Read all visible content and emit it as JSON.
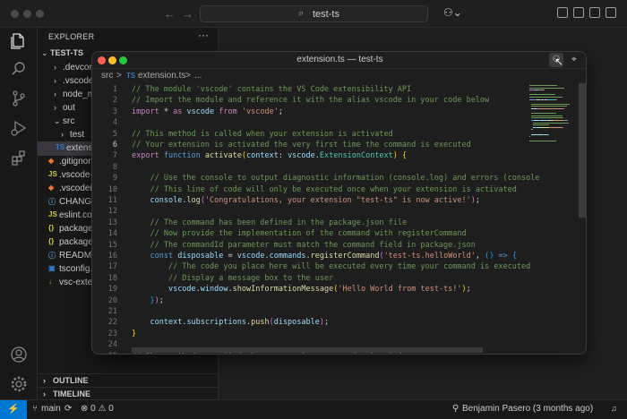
{
  "titlebar": {
    "command_center": "test-ts",
    "back_icon": "arrow-left-icon",
    "forward_icon": "arrow-right-icon",
    "copilot_icon": "copilot-icon"
  },
  "activity_bar": [
    "explorer-icon",
    "search-icon",
    "source-control-icon",
    "run-debug-icon",
    "extensions-icon",
    "accounts-icon",
    "manage-gear-icon"
  ],
  "sidebar": {
    "title": "EXPLORER",
    "more": "···",
    "root": "TEST-TS",
    "items": [
      {
        "label": ".devcontai",
        "icon": "",
        "chev": "›"
      },
      {
        "label": ".vscode",
        "icon": "",
        "chev": "›"
      },
      {
        "label": "node_mod",
        "icon": "",
        "chev": "›"
      },
      {
        "label": "out",
        "icon": "",
        "chev": "›"
      },
      {
        "label": "src",
        "icon": "",
        "chev": "⌄"
      },
      {
        "label": "test",
        "icon": "",
        "chev": "›"
      },
      {
        "label": "extensio",
        "icon": "TS",
        "chev": ""
      },
      {
        "label": ".gitignore",
        "icon": "◆",
        "chev": ""
      },
      {
        "label": ".vscode-t",
        "icon": "JS",
        "chev": ""
      },
      {
        "label": ".vscodeig",
        "icon": "◆",
        "chev": ""
      },
      {
        "label": "CHANGEL",
        "icon": "ⓘ",
        "chev": ""
      },
      {
        "label": "eslint.con",
        "icon": "JS",
        "chev": ""
      },
      {
        "label": "package-",
        "icon": "{}",
        "chev": ""
      },
      {
        "label": "package.j",
        "icon": "{}",
        "chev": ""
      },
      {
        "label": "README.",
        "icon": "ⓘ",
        "chev": ""
      },
      {
        "label": "tsconfig.j",
        "icon": "▣",
        "chev": ""
      },
      {
        "label": "vsc-exten",
        "icon": "↓",
        "chev": ""
      }
    ],
    "outline": "OUTLINE",
    "timeline": "TIMELINE"
  },
  "statusbar": {
    "remote": "⚡",
    "branch": "main",
    "sync": "⟳",
    "problems": "⊗ 0 ⚠ 0",
    "blame": "Benjamin Pasero (3 months ago)",
    "bell": "🔔"
  },
  "editor_window": {
    "title": "extension.ts — test-ts",
    "breadcrumbs": [
      "src",
      ">",
      "TS",
      "extension.ts",
      ">",
      "..."
    ],
    "cursor_line": 6,
    "lines": [
      {
        "n": "1",
        "tokens": [
          [
            "c-com",
            "// The module 'vscode' contains the VS Code extensibility API"
          ]
        ]
      },
      {
        "n": "2",
        "tokens": [
          [
            "c-com",
            "// Import the module and reference it with the alias vscode in your code below"
          ]
        ]
      },
      {
        "n": "3",
        "tokens": [
          [
            "c-kw2",
            "import"
          ],
          [
            "c-op",
            " * "
          ],
          [
            "c-kw2",
            "as"
          ],
          [
            "c-var",
            " vscode "
          ],
          [
            "c-kw2",
            "from"
          ],
          [
            "c-str",
            " 'vscode'"
          ],
          [
            "c-op",
            ";"
          ]
        ]
      },
      {
        "n": "4",
        "tokens": []
      },
      {
        "n": "5",
        "tokens": [
          [
            "c-com",
            "// This method is called when your extension is activated"
          ]
        ]
      },
      {
        "n": "6",
        "tokens": [
          [
            "c-com",
            "// Your extension is activated the very first time the command is executed"
          ]
        ]
      },
      {
        "n": "7",
        "tokens": [
          [
            "c-kw2",
            "export"
          ],
          [
            "c-kw",
            " function "
          ],
          [
            "c-fn",
            "activate"
          ],
          [
            "c-br",
            "("
          ],
          [
            "c-var",
            "context"
          ],
          [
            "c-op",
            ": "
          ],
          [
            "c-var",
            "vscode"
          ],
          [
            "c-op",
            "."
          ],
          [
            "c-type",
            "ExtensionContext"
          ],
          [
            "c-br",
            ")"
          ],
          [
            "c-op",
            " "
          ],
          [
            "c-br",
            "{"
          ]
        ]
      },
      {
        "n": "8",
        "tokens": []
      },
      {
        "n": "9",
        "tokens": [
          [
            "c-op",
            "    "
          ],
          [
            "c-com",
            "// Use the console to output diagnostic information (console.log) and errors (console"
          ]
        ]
      },
      {
        "n": "10",
        "tokens": [
          [
            "c-op",
            "    "
          ],
          [
            "c-com",
            "// This line of code will only be executed once when your extension is activated"
          ]
        ]
      },
      {
        "n": "11",
        "tokens": [
          [
            "c-op",
            "    "
          ],
          [
            "c-var",
            "console"
          ],
          [
            "c-op",
            "."
          ],
          [
            "c-fn",
            "log"
          ],
          [
            "c-br2",
            "("
          ],
          [
            "c-str",
            "'Congratulations, your extension \"test-ts\" is now active!'"
          ],
          [
            "c-br2",
            ")"
          ],
          [
            "c-op",
            ";"
          ]
        ]
      },
      {
        "n": "12",
        "tokens": []
      },
      {
        "n": "13",
        "tokens": [
          [
            "c-op",
            "    "
          ],
          [
            "c-com",
            "// The command has been defined in the package.json file"
          ]
        ]
      },
      {
        "n": "14",
        "tokens": [
          [
            "c-op",
            "    "
          ],
          [
            "c-com",
            "// Now provide the implementation of the command with registerCommand"
          ]
        ]
      },
      {
        "n": "15",
        "tokens": [
          [
            "c-op",
            "    "
          ],
          [
            "c-com",
            "// The commandId parameter must match the command field in package.json"
          ]
        ]
      },
      {
        "n": "16",
        "tokens": [
          [
            "c-op",
            "    "
          ],
          [
            "c-kw",
            "const"
          ],
          [
            "c-var",
            " disposable "
          ],
          [
            "c-op",
            "= "
          ],
          [
            "c-var",
            "vscode"
          ],
          [
            "c-op",
            "."
          ],
          [
            "c-var",
            "commands"
          ],
          [
            "c-op",
            "."
          ],
          [
            "c-fn",
            "registerCommand"
          ],
          [
            "c-br2",
            "("
          ],
          [
            "c-str",
            "'test-ts.helloWorld'"
          ],
          [
            "c-op",
            ", "
          ],
          [
            "c-br3",
            "()"
          ],
          [
            "c-kw",
            " => "
          ],
          [
            "c-br3",
            "{"
          ]
        ]
      },
      {
        "n": "17",
        "tokens": [
          [
            "c-op",
            "        "
          ],
          [
            "c-com",
            "// The code you place here will be executed every time your command is executed"
          ]
        ]
      },
      {
        "n": "18",
        "tokens": [
          [
            "c-op",
            "        "
          ],
          [
            "c-com",
            "// Display a message box to the user"
          ]
        ]
      },
      {
        "n": "19",
        "tokens": [
          [
            "c-op",
            "        "
          ],
          [
            "c-var",
            "vscode"
          ],
          [
            "c-op",
            "."
          ],
          [
            "c-var",
            "window"
          ],
          [
            "c-op",
            "."
          ],
          [
            "c-fn",
            "showInformationMessage"
          ],
          [
            "c-br",
            "("
          ],
          [
            "c-str",
            "'Hello World from test-ts!'"
          ],
          [
            "c-br",
            ")"
          ],
          [
            "c-op",
            ";"
          ]
        ]
      },
      {
        "n": "20",
        "tokens": [
          [
            "c-op",
            "    "
          ],
          [
            "c-br3",
            "}"
          ],
          [
            "c-br2",
            ")"
          ],
          [
            "c-op",
            ";"
          ]
        ]
      },
      {
        "n": "21",
        "tokens": []
      },
      {
        "n": "22",
        "tokens": [
          [
            "c-op",
            "    "
          ],
          [
            "c-var",
            "context"
          ],
          [
            "c-op",
            "."
          ],
          [
            "c-var",
            "subscriptions"
          ],
          [
            "c-op",
            "."
          ],
          [
            "c-fn",
            "push"
          ],
          [
            "c-br2",
            "("
          ],
          [
            "c-var",
            "disposable"
          ],
          [
            "c-br2",
            ")"
          ],
          [
            "c-op",
            ";"
          ]
        ]
      },
      {
        "n": "23",
        "tokens": [
          [
            "c-br",
            "}"
          ]
        ]
      },
      {
        "n": "24",
        "tokens": []
      },
      {
        "n": "25",
        "tokens": [
          [
            "c-com",
            "// This method is called when your extension is deactivated"
          ]
        ]
      }
    ]
  },
  "colors": {
    "accent": "#0078d4",
    "close": "#ff5f57",
    "minimize": "#febc2e",
    "maximize": "#28c840"
  }
}
